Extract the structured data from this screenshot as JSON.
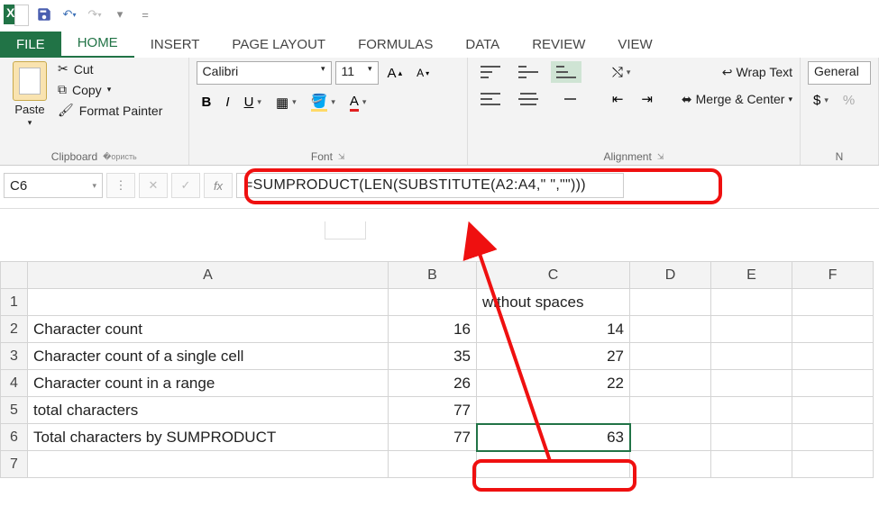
{
  "qat": {
    "save_tip": "Save",
    "undo_tip": "Undo",
    "redo_tip": "Redo"
  },
  "tabs": {
    "file": "FILE",
    "home": "HOME",
    "insert": "INSERT",
    "page_layout": "PAGE LAYOUT",
    "formulas": "FORMULAS",
    "data": "DATA",
    "review": "REVIEW",
    "view": "VIEW"
  },
  "ribbon": {
    "clipboard": {
      "paste": "Paste",
      "cut": "Cut",
      "copy": "Copy",
      "format_painter": "Format Painter",
      "label": "Clipboard"
    },
    "font": {
      "name": "Calibri",
      "size": "11",
      "label": "Font"
    },
    "alignment": {
      "wrap": "Wrap Text",
      "merge": "Merge & Center",
      "label": "Alignment"
    },
    "number": {
      "format": "General",
      "currency": "$",
      "label": "N"
    }
  },
  "formula_bar": {
    "name_box": "C6",
    "fx_label": "fx",
    "formula": "=SUMPRODUCT(LEN(SUBSTITUTE(A2:A4,\" \",\"\")))"
  },
  "grid": {
    "cols": [
      "A",
      "B",
      "C",
      "D",
      "E",
      "F"
    ],
    "rows": [
      {
        "n": "1",
        "A": "",
        "B": "",
        "C": "without spaces",
        "D": "",
        "E": "",
        "F": ""
      },
      {
        "n": "2",
        "A": "Character count",
        "B": "16",
        "C": "14",
        "D": "",
        "E": "",
        "F": ""
      },
      {
        "n": "3",
        "A": "Character count of a single cell",
        "B": "35",
        "C": "27",
        "D": "",
        "E": "",
        "F": ""
      },
      {
        "n": "4",
        "A": "Character count in a range",
        "B": "26",
        "C": "22",
        "D": "",
        "E": "",
        "F": ""
      },
      {
        "n": "5",
        "A": "total characters",
        "B": "77",
        "C": "",
        "D": "",
        "E": "",
        "F": ""
      },
      {
        "n": "6",
        "A": "Total characters by SUMPRODUCT",
        "B": "77",
        "C": "63",
        "D": "",
        "E": "",
        "F": ""
      },
      {
        "n": "7",
        "A": "",
        "B": "",
        "C": "",
        "D": "",
        "E": "",
        "F": ""
      }
    ],
    "active_col": "C",
    "active_row": "6"
  }
}
